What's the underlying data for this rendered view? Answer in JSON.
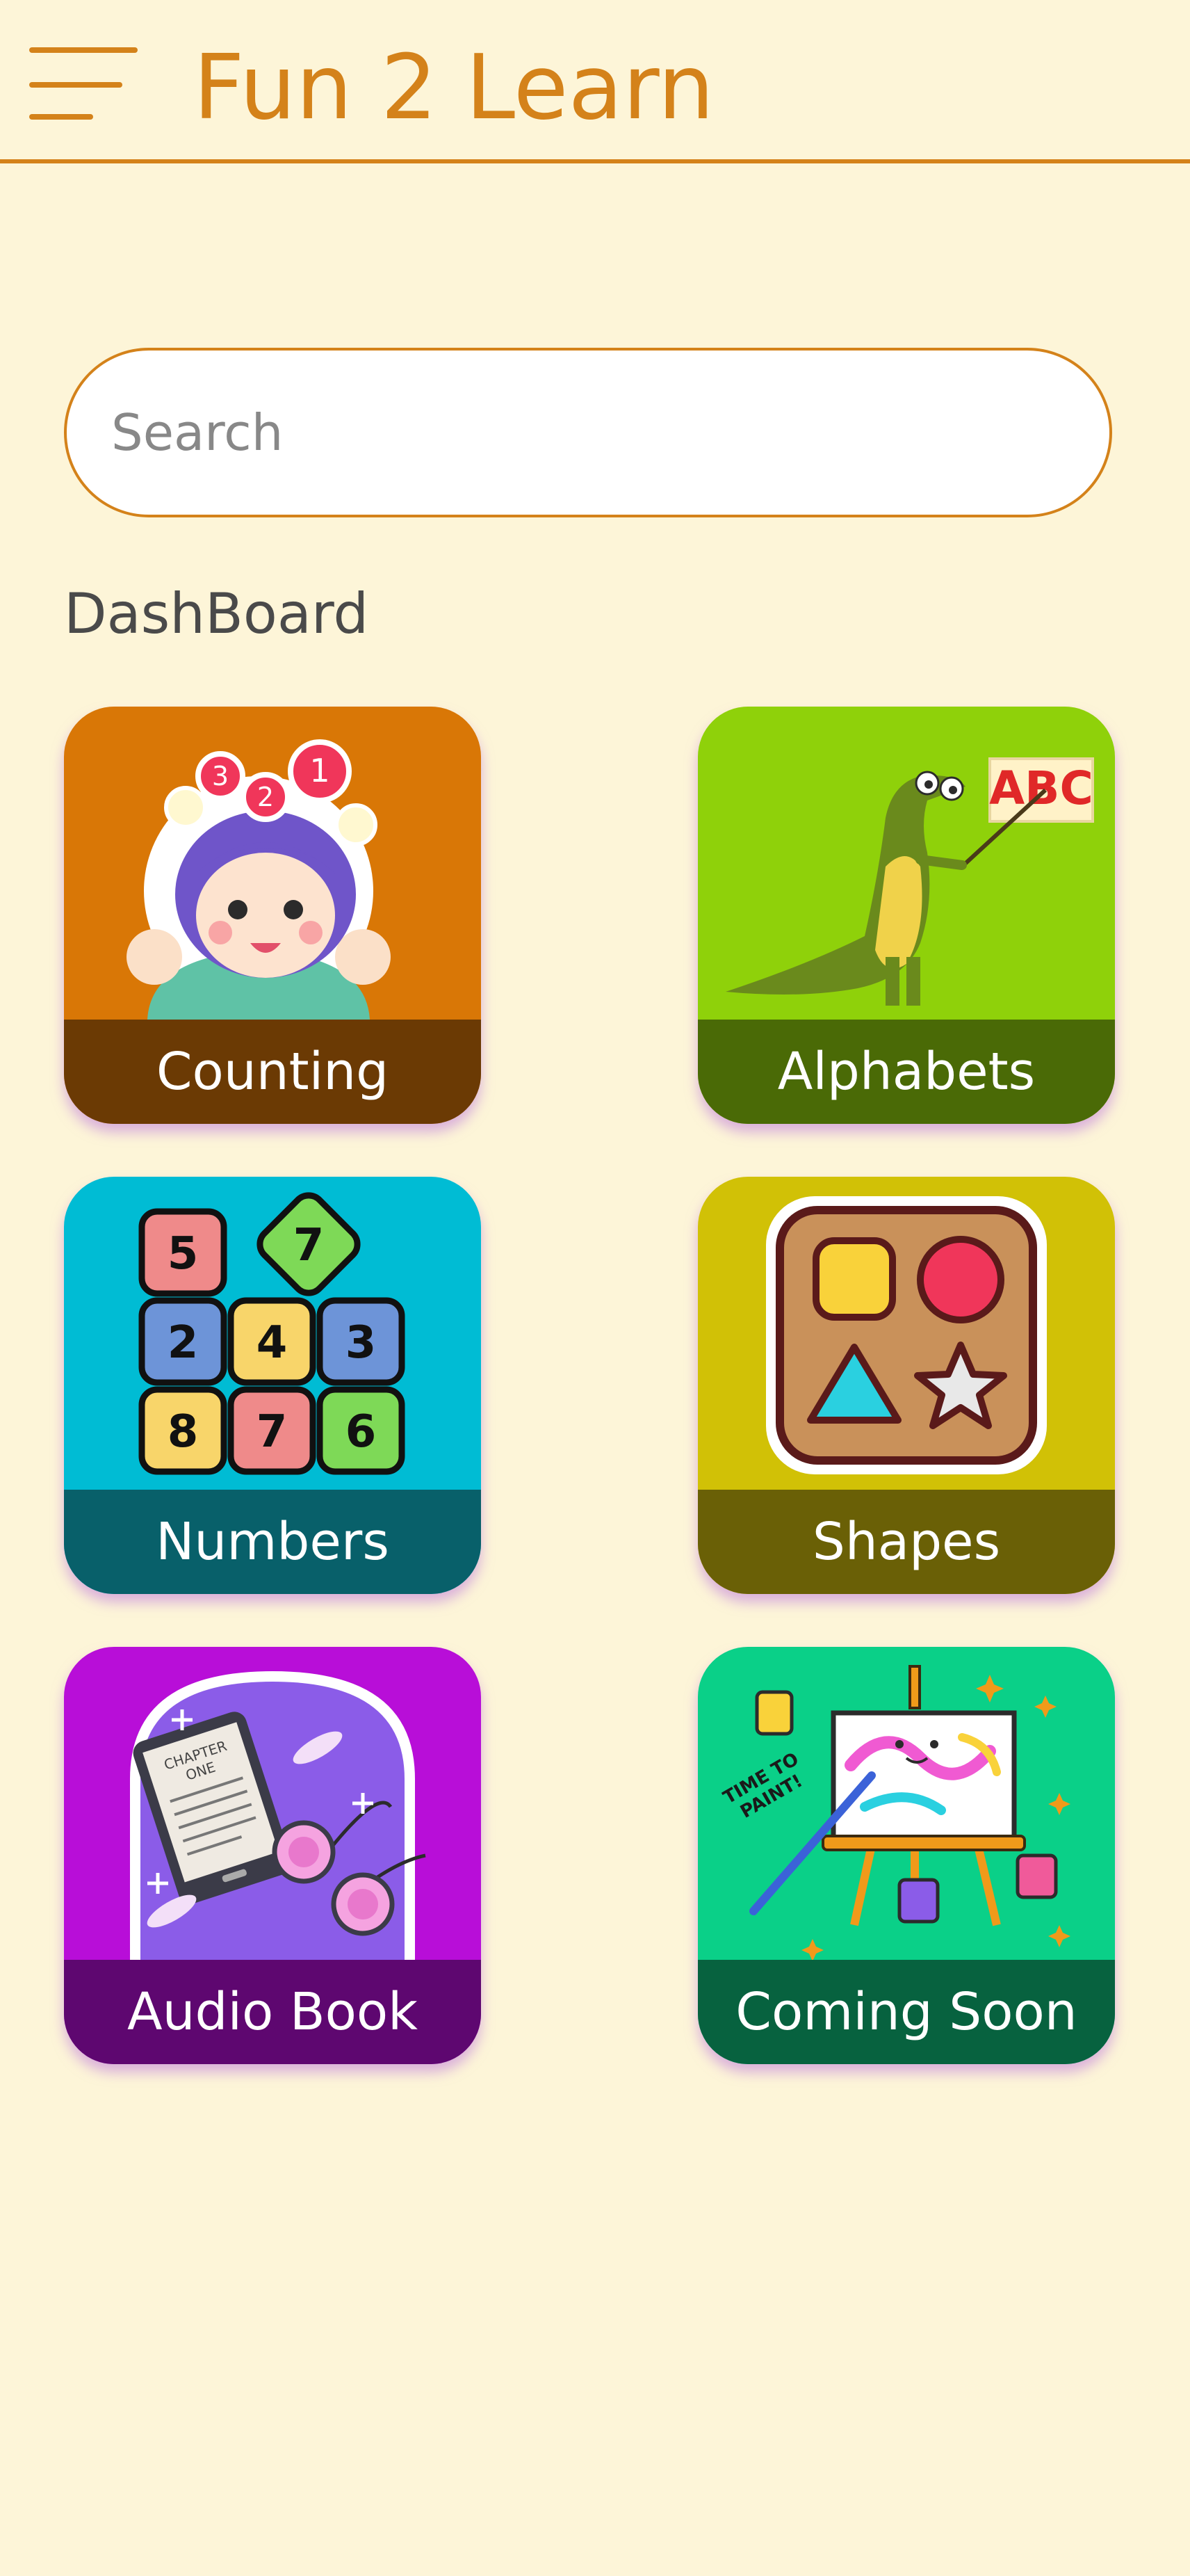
{
  "app": {
    "title": "Fun 2 Learn"
  },
  "search": {
    "placeholder": "Search"
  },
  "dashboard": {
    "title": "DashBoard",
    "tiles": [
      {
        "label": "Counting",
        "icon": "girl-counting-icon",
        "bg": "#d97706",
        "band": "#6b3a04"
      },
      {
        "label": "Alphabets",
        "icon": "crocodile-teacher-icon",
        "bg": "#8fd10a",
        "band": "#4a6a06"
      },
      {
        "label": "Numbers",
        "icon": "number-blocks-icon",
        "bg": "#00bcd4",
        "band": "#08606a"
      },
      {
        "label": "Shapes",
        "icon": "shape-sorter-icon",
        "bg": "#d1c106",
        "band": "#6a6006"
      },
      {
        "label": "Audio Book",
        "icon": "ebook-headphones-icon",
        "bg": "#b80ed8",
        "band": "#5e0770"
      },
      {
        "label": "Coming Soon",
        "icon": "paint-easel-icon",
        "bg": "#0ad088",
        "band": "#07623f"
      }
    ]
  },
  "art_text": {
    "counting_numbers": [
      "3",
      "2",
      "1"
    ],
    "abc_sign": "ABC",
    "number_blocks": [
      "5",
      "7",
      "2",
      "4",
      "3",
      "8",
      "7",
      "6"
    ],
    "chapter": [
      "CHAPTER",
      "ONE"
    ],
    "paint_caption": [
      "TIME TO",
      "PAINT!"
    ]
  }
}
